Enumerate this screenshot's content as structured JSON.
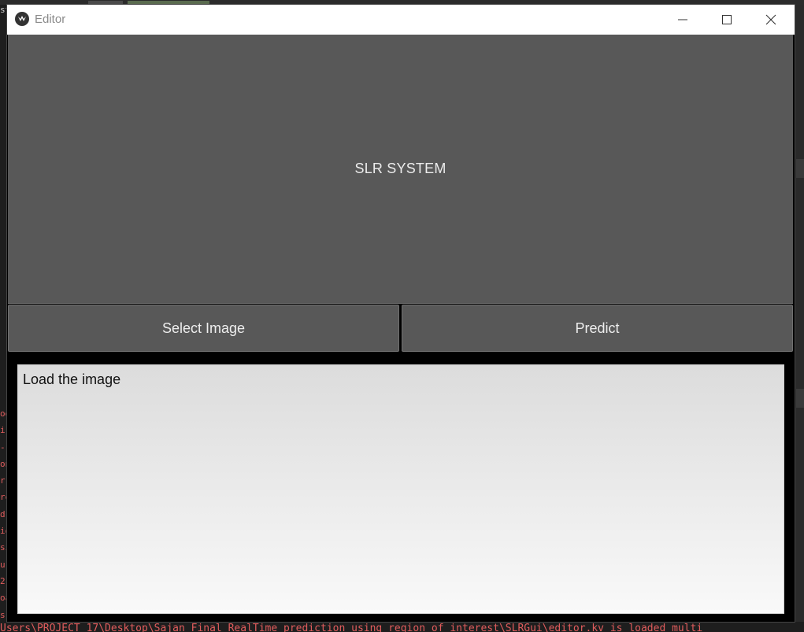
{
  "window": {
    "title": "Editor"
  },
  "header": {
    "label": "SLR SYSTEM"
  },
  "buttons": {
    "select_image": "Select Image",
    "predict": "Predict"
  },
  "output": {
    "text": "Load the image"
  },
  "background_console": {
    "bottom_line": "Users\\PROJECT 17\\Desktop\\Sajan Final RealTime prediction using region of interest\\SLRGui\\editor.kv is loaded multi",
    "left_fragments": [
      "oe",
      "i:",
      " -",
      "on",
      "r",
      "re",
      "d",
      "io",
      "si",
      "ur",
      "2",
      "oa",
      " s"
    ],
    "left_top": "st"
  },
  "colors": {
    "panel": "#585858",
    "window_bg": "#000000",
    "console_text": "#e05c5c"
  }
}
